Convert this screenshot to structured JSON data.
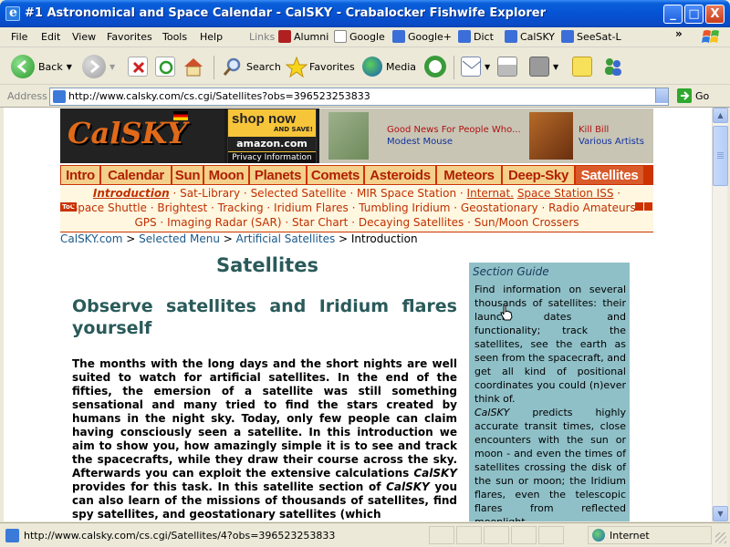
{
  "window": {
    "title": "#1 Astronomical and Space Calendar - CalSKY - Crabalocker Fishwife Explorer",
    "buttons": {
      "minimize": "_",
      "maximize": "□",
      "close": "X"
    }
  },
  "menubar": {
    "items": [
      "File",
      "Edit",
      "View",
      "Favorites",
      "Tools",
      "Help"
    ],
    "links_label": "Links",
    "links": [
      "Alumni",
      "Google",
      "Google+",
      "Dict",
      "CalSKY",
      "SeeSat-L"
    ],
    "chevron": "»"
  },
  "toolbar": {
    "back": "Back",
    "search": "Search",
    "favorites": "Favorites",
    "media": "Media"
  },
  "address": {
    "label": "Address",
    "url": "http://www.calsky.com/cs.cgi/Satellites?obs=396523253833",
    "go": "Go"
  },
  "site_header": {
    "logo": "CalSKY",
    "amazon": {
      "shop": "shop now",
      "save": "AND SAVE!",
      "brand": "amazon.com",
      "privacy": "Privacy Information"
    },
    "ad1": {
      "title": "Good News For People Who...",
      "artist": "Modest Mouse"
    },
    "ad2": {
      "title": "Kill Bill",
      "artist": "Various Artists"
    }
  },
  "nav": {
    "tabs": [
      "Intro",
      "Calendar",
      "Sun",
      "Moon",
      "Planets",
      "Comets",
      "Asteroids",
      "Meteors",
      "Deep-Sky",
      "Satellites"
    ],
    "active": "Satellites"
  },
  "subnav": {
    "toc": "ToC",
    "line1": [
      "Introduction",
      "Sat-Library",
      "Selected Satellite",
      "MIR Space Station",
      "Internat.",
      "Space Station ISS"
    ],
    "line2": [
      "Space Shuttle",
      "Brightest",
      "Tracking",
      "Iridium Flares",
      "Tumbling Iridium",
      "Geostationary",
      "Radio Amateurs"
    ],
    "line3": [
      "GPS",
      "Imaging Radar (SAR)",
      "Star Chart",
      "Decaying Satellites",
      "Sun/Moon Crossers"
    ],
    "separator": " · "
  },
  "breadcrumb": {
    "items": [
      "CalSKY.com",
      "Selected Menu",
      "Artificial Satellites"
    ],
    "current": "Introduction",
    "sep": " > "
  },
  "content": {
    "title": "Satellites",
    "heading": "Observe satellites and Iridium flares yourself",
    "paragraph_parts": [
      "The months with the long days and the short nights are well suited to watch for artificial satellites. In the end of the fifties, the emersion of a satellite was still something sensational and many tried to find the stars created by humans in the night sky. Today, only few people can claim having consciously seen a satellite. In this introduction we aim to show you, how amazingly simple it is to see and track the spacecrafts, while they draw their course across the sky. Afterwards you can exploit the extensive calculations ",
      "CalSKY",
      " provides for this task. In this satellite section of ",
      "CalSKY",
      " you can also learn of the missions of thousands of satellites, find spy satellites, and geostationary satellites (which"
    ]
  },
  "guide": {
    "title": "Section Guide",
    "p1": "Find information on several thousands of satellites: their launch dates and functionality; track the satellites, see the earth as seen from the spacecraft, and get all kind of positional coordinates you could (n)ever think of.",
    "p2_brand": "CalSKY",
    "p2": " predicts highly accurate transit times, close encounters with the sun or moon - and even the times of satellites crossing the disk of the sun or moon; the Iridium flares, even the telescopic flares from reflected moonlight."
  },
  "status": {
    "text": "http://www.calsky.com/cs.cgi/Satellites/4?obs=396523253833",
    "zone": "Internet"
  }
}
